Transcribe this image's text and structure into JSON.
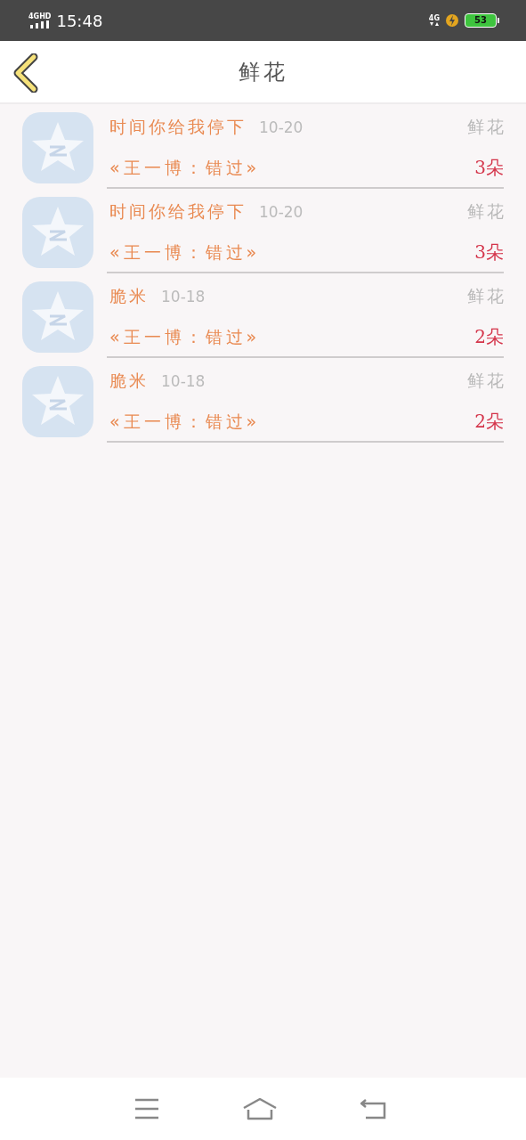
{
  "status_bar": {
    "network_left": "4GHD",
    "time": "15:48",
    "network_right": "4G",
    "battery": "53"
  },
  "header": {
    "title": "鲜花"
  },
  "gifts": [
    {
      "sender": "时间你给我停下",
      "date": "10-20",
      "gift": "鲜花",
      "song": "«王一博：错过»",
      "count": "3朵"
    },
    {
      "sender": "时间你给我停下",
      "date": "10-20",
      "gift": "鲜花",
      "song": "«王一博：错过»",
      "count": "3朵"
    },
    {
      "sender": "脆米",
      "date": "10-18",
      "gift": "鲜花",
      "song": "«王一博：错过»",
      "count": "2朵"
    },
    {
      "sender": "脆米",
      "date": "10-18",
      "gift": "鲜花",
      "song": "«王一博：错过»",
      "count": "2朵"
    }
  ]
}
